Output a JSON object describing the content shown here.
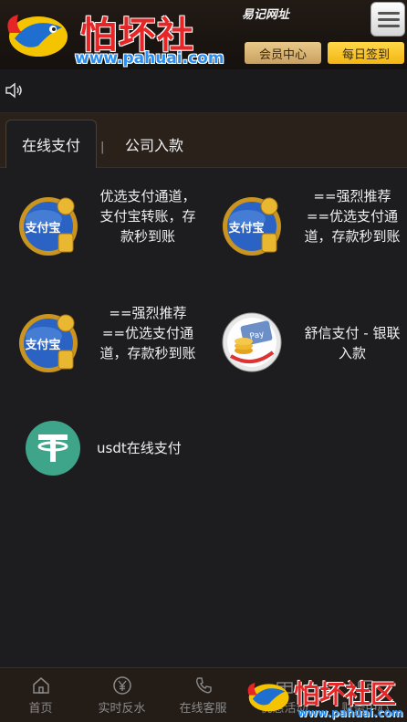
{
  "header": {
    "brand": "怕坏社区",
    "url": "www.pahuai.com",
    "site_note": "易记网址",
    "member_center": "会员中心",
    "daily_sign": "每日签到"
  },
  "tabs": {
    "online": "在线支付",
    "separator": "|",
    "company": "公司入款"
  },
  "payments": [
    {
      "label": "优选支付通道，支付宝转账，存款秒到账",
      "icon": "alipay-icon"
    },
    {
      "label": "==强烈推荐==优选支付通道，存款秒到账",
      "icon": "alipay-icon"
    },
    {
      "label": "==强烈推荐==优选支付通道，存款秒到账",
      "icon": "alipay-icon"
    },
    {
      "label": "舒信支付 - 银联入款",
      "icon": "unionpay-icon"
    },
    {
      "label": "usdt在线支付",
      "icon": "tether-icon"
    }
  ],
  "bottom_nav": [
    {
      "label": "首页",
      "icon": "home-icon"
    },
    {
      "label": "实时反水",
      "icon": "yen-icon"
    },
    {
      "label": "在线客服",
      "icon": "phone-icon"
    },
    {
      "label": "优惠活动",
      "icon": "gift-icon"
    },
    {
      "label": "财务中心",
      "icon": "wallet-icon"
    }
  ],
  "watermark": {
    "brand": "怕坏社区",
    "url": "www.pahuai.com"
  },
  "colors": {
    "background": "#1d1c1f",
    "brand_red": "#e62626",
    "brand_blue": "#2c8ff0",
    "gold": "#f3b612",
    "tether_green": "#3fa58a"
  }
}
